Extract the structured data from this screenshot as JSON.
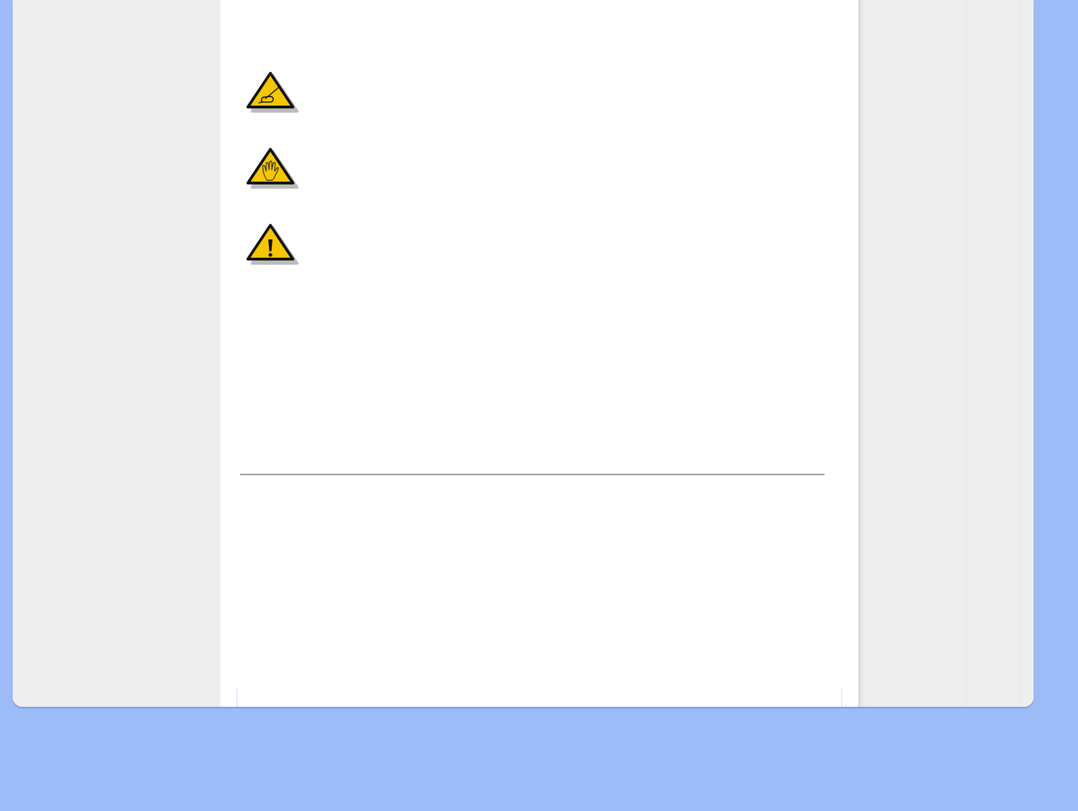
{
  "notices": [
    {
      "kind": "note"
    },
    {
      "kind": "caution"
    },
    {
      "kind": "warning"
    }
  ]
}
